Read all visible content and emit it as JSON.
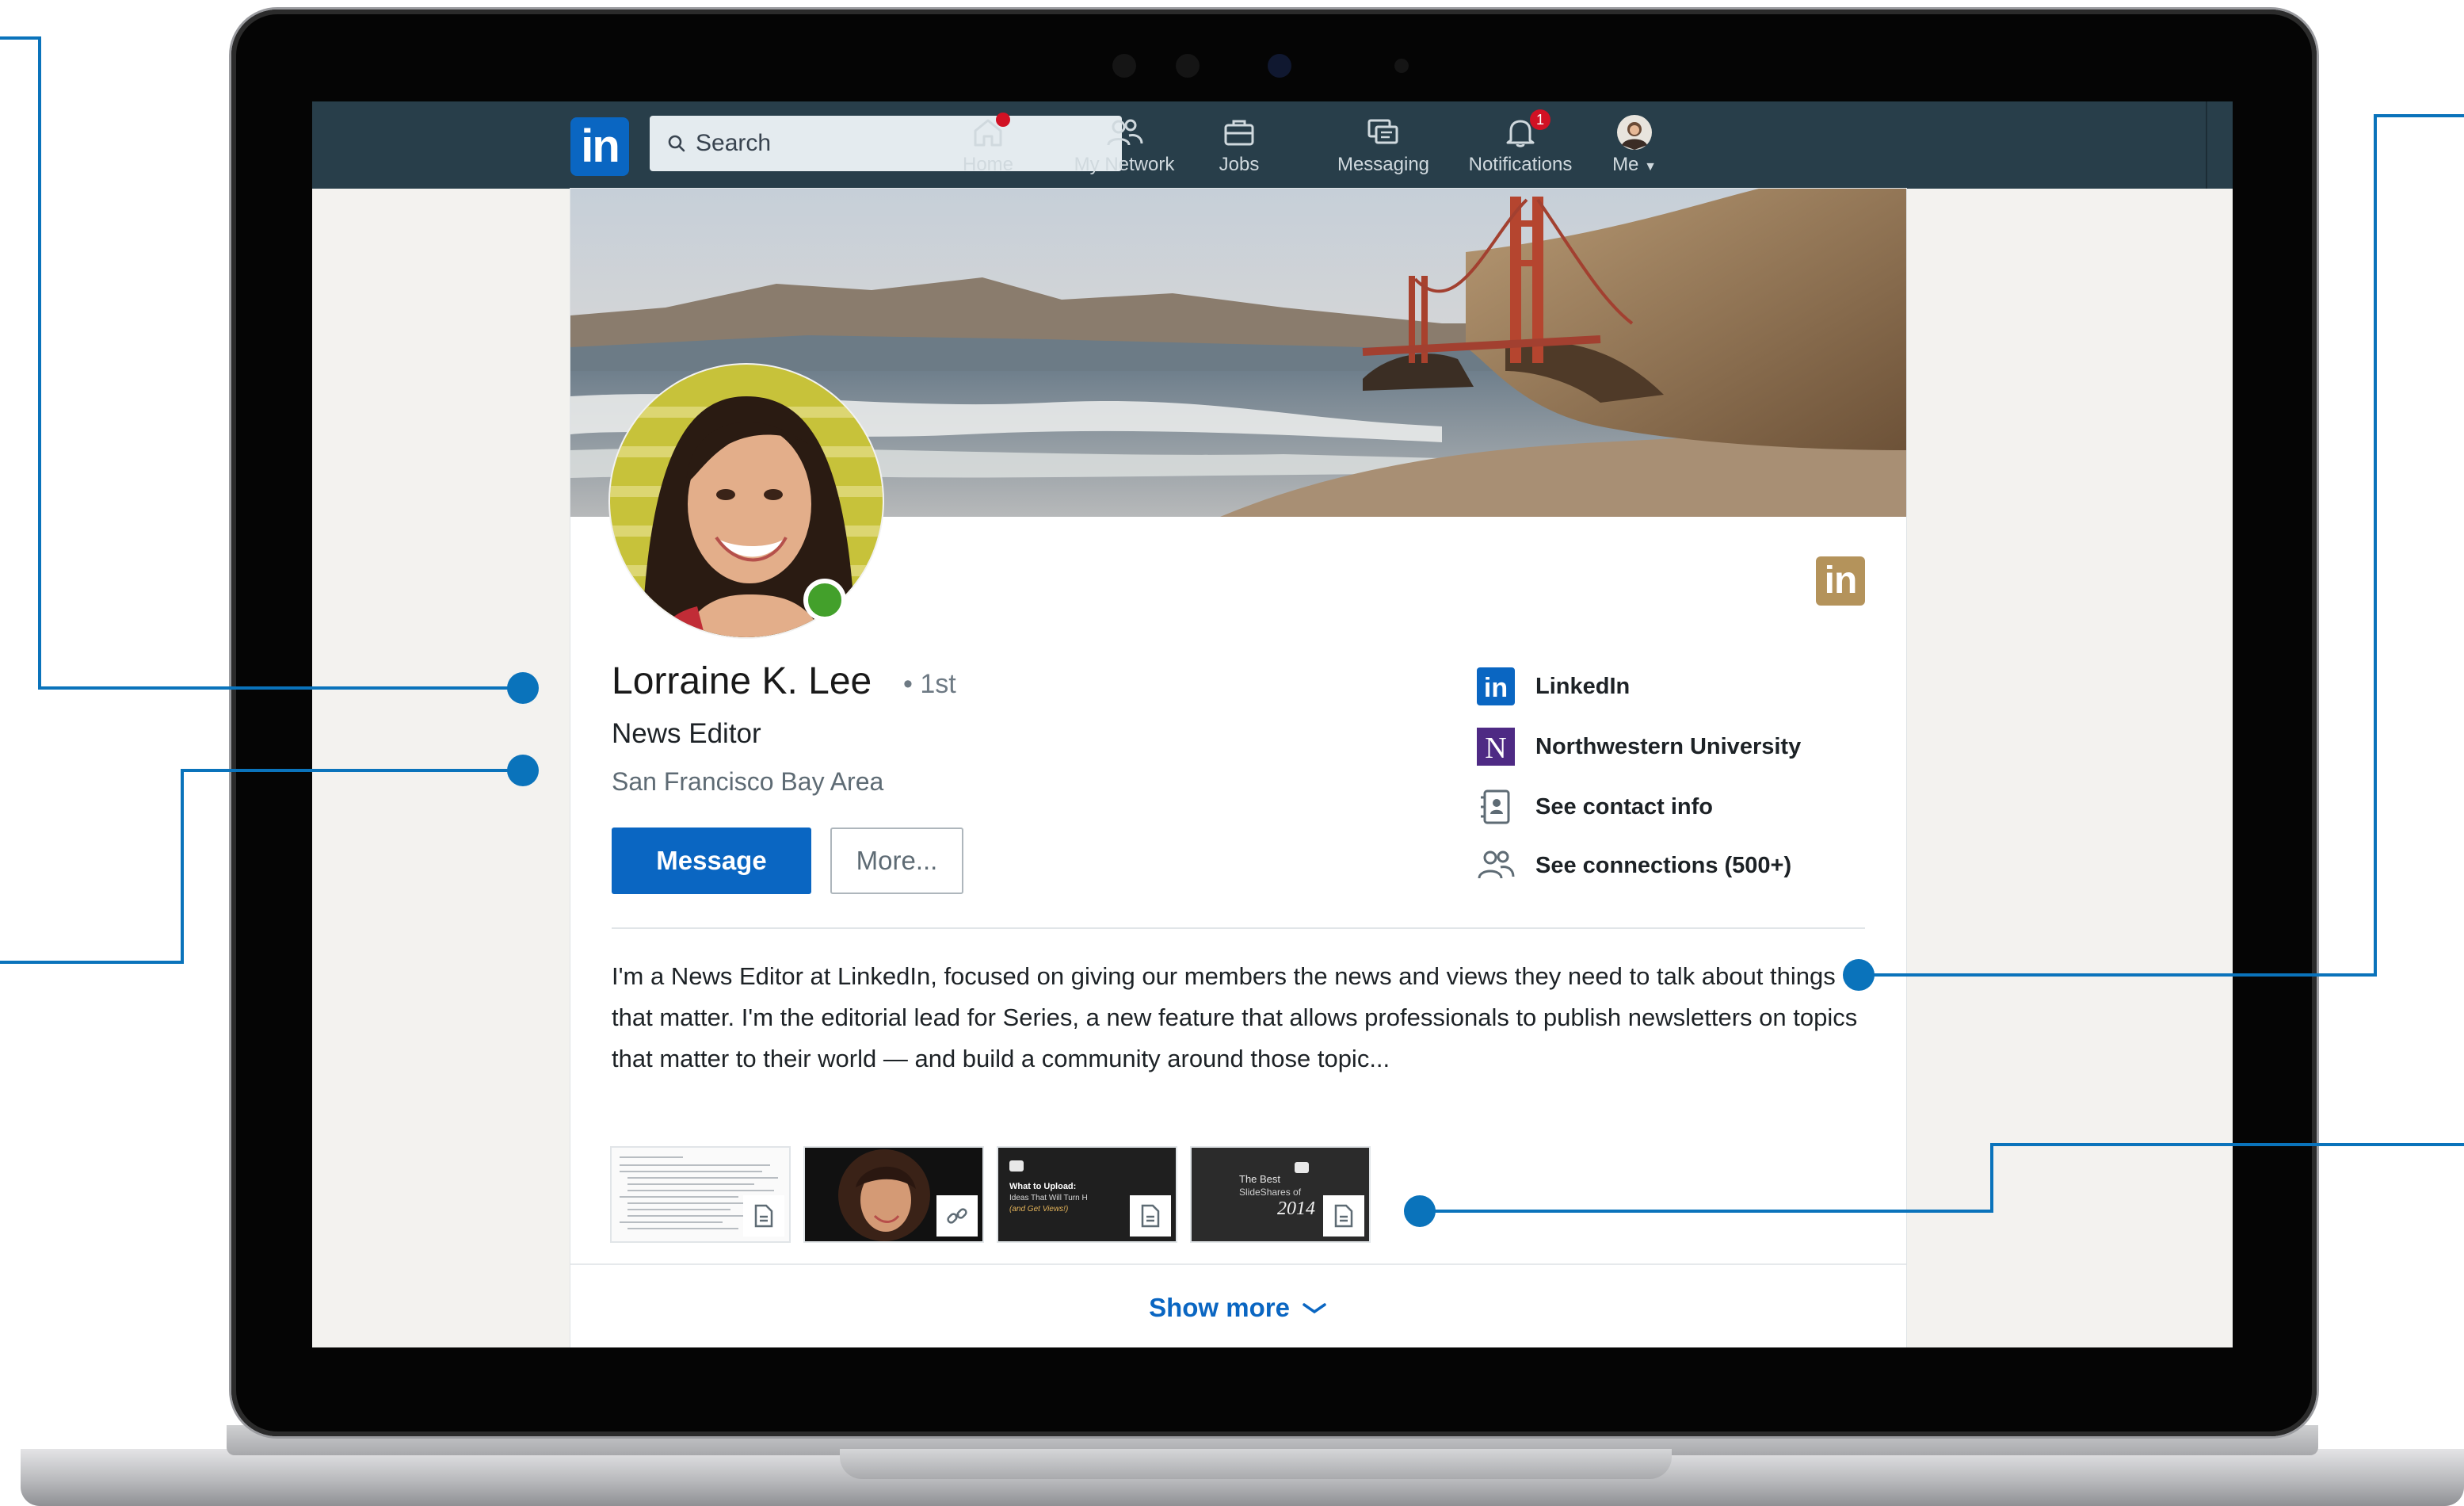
{
  "nav": {
    "logo": "in",
    "search_placeholder": "Search",
    "items": [
      {
        "label": "Home",
        "icon": "home-icon",
        "badge": ""
      },
      {
        "label": "My Network",
        "icon": "network-icon",
        "badge": ""
      },
      {
        "label": "Jobs",
        "icon": "briefcase-icon",
        "badge": ""
      },
      {
        "label": "Messaging",
        "icon": "messaging-icon",
        "badge": ""
      },
      {
        "label": "Notifications",
        "icon": "bell-icon",
        "badge": "1"
      },
      {
        "label": "Me",
        "icon": "avatar-icon",
        "badge": ""
      }
    ]
  },
  "profile": {
    "name": "Lorraine K. Lee",
    "degree": "• 1st",
    "headline": "News Editor",
    "location": "San Francisco Bay Area",
    "message_label": "Message",
    "more_label": "More...",
    "company_badge": "in",
    "info": {
      "company": "LinkedIn",
      "school": "Northwestern University",
      "contact": "See contact info",
      "connections": "See connections (500+)"
    },
    "summary": "I'm a News Editor at LinkedIn, focused on giving our members the news and views they need to talk about things that matter. I'm the editorial lead for Series, a new feature that allows professionals to publish newsletters on topics that matter to their world — and build a community around those topic...",
    "media": [
      {
        "type": "document",
        "title": ""
      },
      {
        "type": "link",
        "title": ""
      },
      {
        "type": "document",
        "title": "What to Upload: Ideas That Will Turn Heads (and Get Views!)"
      },
      {
        "type": "document",
        "title": "The Best SlideShares of 2014"
      }
    ],
    "show_more": "Show more"
  },
  "colors": {
    "nav_bg": "#283e4a",
    "brand_blue": "#0a66c2",
    "callout": "#0a73bb",
    "online": "#43a02b",
    "badge_red": "#d11124"
  }
}
